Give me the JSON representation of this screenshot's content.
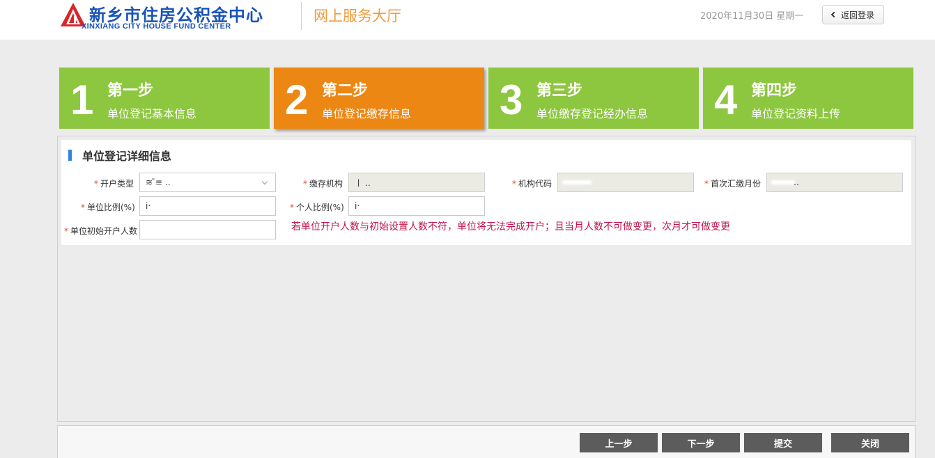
{
  "header": {
    "logo_cn": "新乡市住房公积金中心",
    "logo_en": "XINXIANG CITY HOUSE FUND CENTER",
    "hall_title": "网上服务大厅",
    "date": "2020年11月30日 星期一",
    "back_label": "返回登录"
  },
  "steps": [
    {
      "num": "1",
      "title": "第一步",
      "sub": "单位登记基本信息",
      "active": false
    },
    {
      "num": "2",
      "title": "第二步",
      "sub": "单位登记缴存信息",
      "active": true
    },
    {
      "num": "3",
      "title": "第三步",
      "sub": "单位缴存登记经办信息",
      "active": false
    },
    {
      "num": "4",
      "title": "第四步",
      "sub": "单位登记资料上传",
      "active": false
    }
  ],
  "form": {
    "section_title": "单位登记详细信息",
    "required_mark": "*",
    "fields": {
      "open_type": {
        "label": "开户类型",
        "value": "≋ ̄≡ ‥"
      },
      "deposit_org": {
        "label": "缴存机构",
        "value": "ㅣ  ‥"
      },
      "org_code": {
        "label": "机构代码",
        "value": ""
      },
      "first_month": {
        "label": "首次汇缴月份",
        "value": "‥"
      },
      "unit_ratio": {
        "label": "单位比例(%)",
        "value": "i‧"
      },
      "personal_ratio": {
        "label": "个人比例(%)",
        "value": "i‧"
      },
      "initial_count": {
        "label": "单位初始开户人数",
        "value": ""
      }
    },
    "warning": "若单位开户人数与初始设置人数不符，单位将无法完成开户；且当月人数不可做变更，次月才可做变更"
  },
  "footer": {
    "prev": "上一步",
    "next": "下一步",
    "submit": "提交",
    "close": "关闭"
  },
  "colors": {
    "step_green": "#8dc63f",
    "step_orange": "#ec8714",
    "brand_blue": "#1a54b8",
    "warning_red": "#c2144a",
    "button_gray": "#5d5c5c"
  }
}
